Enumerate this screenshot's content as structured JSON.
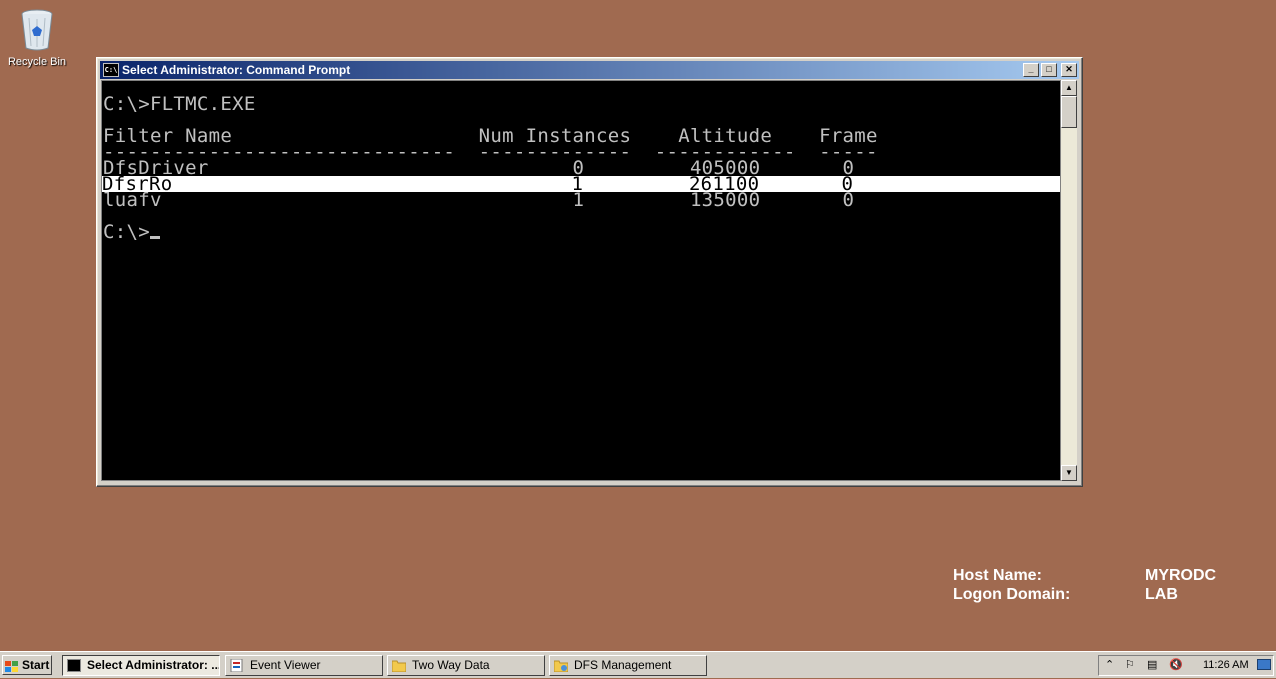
{
  "desktop": {
    "recycle_bin_label": "Recycle Bin",
    "background_color": "#a06a50"
  },
  "window": {
    "title": "Select Administrator: Command Prompt",
    "icon_text": "C:\\",
    "minimize": "_",
    "maximize": "□",
    "close": "✕",
    "console_lines": [
      "C:\\>FLTMC.EXE",
      "Filter Name                     Num Instances    Altitude    Frame",
      "------------------------------  -------------  ------------  -----",
      "DfsDriver                               0         405000       0",
      "DfsrRo                                  1         261100       0",
      "luafv                                   1         135000       0",
      "C:\\>"
    ],
    "highlighted_row": "DfsrRo"
  },
  "hostinfo": {
    "host_label": "Host Name:",
    "host_value": "MYRODC",
    "domain_label": "Logon Domain:",
    "domain_value": "LAB"
  },
  "taskbar": {
    "start_label": "Start",
    "tasks": [
      {
        "label": "Select Administrator: ...",
        "icon": "cmd-icon",
        "active": true
      },
      {
        "label": "Event Viewer",
        "icon": "event-viewer-icon",
        "active": false
      },
      {
        "label": "Two Way Data",
        "icon": "folder-icon",
        "active": false
      },
      {
        "label": "DFS Management",
        "icon": "dfs-management-icon",
        "active": false
      }
    ],
    "clock": "11:26 AM"
  }
}
